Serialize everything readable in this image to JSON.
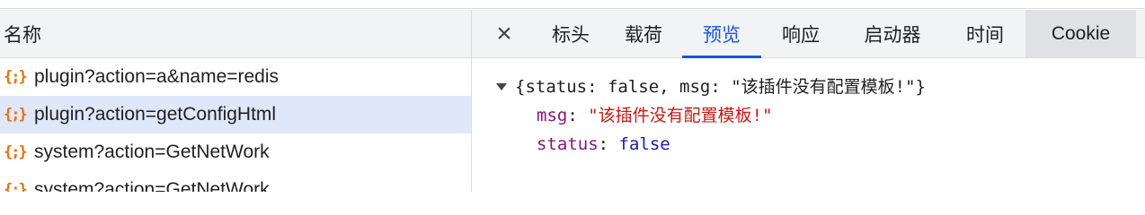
{
  "colors": {
    "accent": "#1a56d6",
    "selected_row": "#dfe7fb",
    "json_icon": "#e8710a"
  },
  "list": {
    "header": "名称",
    "rows": [
      {
        "icon": "{;}",
        "label": "plugin?action=a&name=redis"
      },
      {
        "icon": "{;}",
        "label": "plugin?action=getConfigHtml",
        "selected": true
      },
      {
        "icon": "{;}",
        "label": "system?action=GetNetWork"
      },
      {
        "icon": "{;}",
        "label": "system?action=GetNetWork"
      }
    ]
  },
  "tabs": {
    "close_icon": "×",
    "items": [
      "标头",
      "载荷",
      "预览",
      "响应",
      "启动器",
      "时间",
      "Cookie"
    ],
    "active": "预览"
  },
  "preview": {
    "summary": "{status: false, msg: \"该插件没有配置模板!\"}",
    "msg_key": "msg",
    "msg_value": "\"该插件没有配置模板!\"",
    "status_key": "status",
    "status_value": "false"
  }
}
